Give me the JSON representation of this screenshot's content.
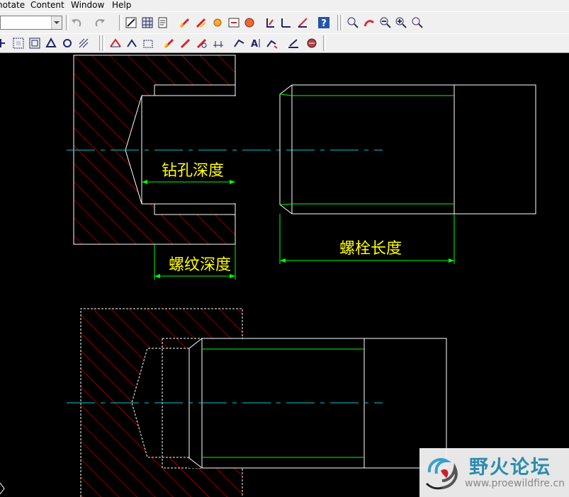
{
  "menu": {
    "items": [
      "notate",
      "Content",
      "Window",
      "Help"
    ]
  },
  "toolbar1": {
    "icons": [
      "undo-icon",
      "redo-icon",
      "line-style-icon",
      "grid-table-icon",
      "file-list-icon",
      "pen-icon",
      "pen-edit-icon",
      "node-icon",
      "move-icon",
      "rotate-icon",
      "ruler-icon",
      "angle-icon",
      "align-icon",
      "help-icon",
      "zoom-in-icon",
      "zoom-pan-icon",
      "zoom-out-icon",
      "zoom-window-icon",
      "zoom-all-icon"
    ]
  },
  "toolbar2": {
    "icons": [
      "snap-icon",
      "grid-snap-icon",
      "ortho-icon",
      "polar-icon",
      "osnap-icon",
      "otrack-icon",
      "hatch-icon",
      "hatch-edit-icon",
      "boundary-icon",
      "point-icon",
      "dimension-icon",
      "pen-tool-icon",
      "pen-angle-icon",
      "pen-curve-icon",
      "dim-linear-icon",
      "text-icon",
      "leader-icon",
      "weld-icon",
      "properties-icon"
    ]
  },
  "drawing": {
    "labels": {
      "drill_depth": "钻孔深度",
      "thread_depth": "螺纹深度",
      "bolt_length": "螺栓长度"
    },
    "colors": {
      "hatch": "#ff0000",
      "outline": "#ffffff",
      "thread": "#00ff00",
      "centerline": "#00cccc",
      "dim_text": "#ffff00",
      "dimension": "#00ff00"
    }
  },
  "watermark": {
    "title": "野火论坛",
    "url": "www.proewildfire.cn"
  }
}
